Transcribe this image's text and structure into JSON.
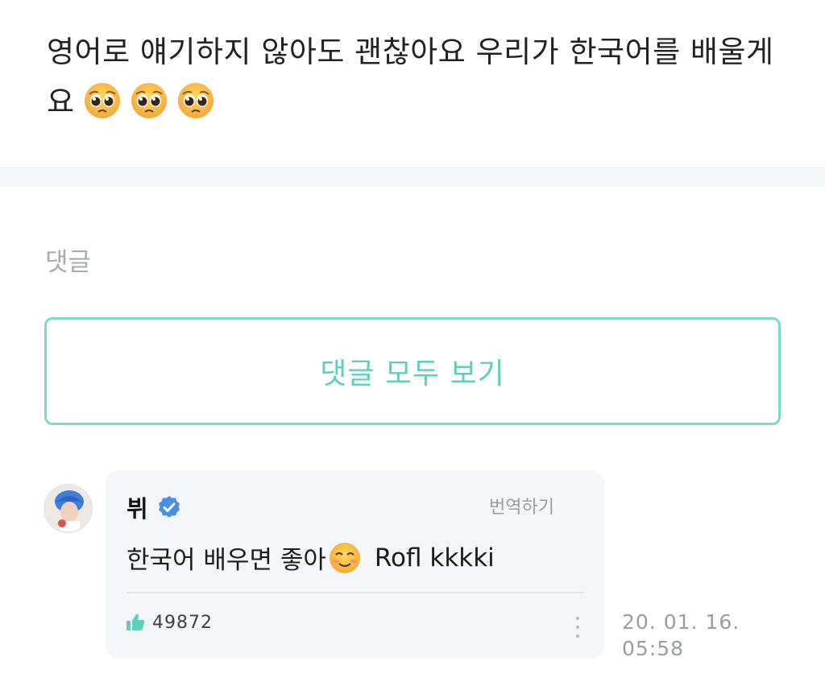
{
  "post": {
    "text": "영어로 얘기하지 않아도 괜찮아요 우리가 한국어를 배울게요",
    "emojis": [
      "pleading-face-emoji",
      "pleading-face-emoji",
      "pleading-face-emoji"
    ]
  },
  "comments": {
    "heading": "댓글",
    "view_all_label": "댓글 모두 보기",
    "items": [
      {
        "author": "뷔",
        "verified": true,
        "translate_label": "번역하기",
        "text_before": "한국어 배우면 좋아",
        "emoji": "smiling-face-emoji",
        "text_after": "Rofl kkkki",
        "like_icon": "thumbs-up-icon",
        "likes": "49872",
        "more_icon": "more-vertical-icon",
        "date": "20. 01. 16.",
        "time": "05:58"
      }
    ]
  },
  "colors": {
    "accent": "#5ccfbf",
    "accent_border": "#7dd9cb",
    "muted_text": "#9a9ca3",
    "bubble_bg": "#f4f6f9",
    "verified_blue": "#4a90e2"
  }
}
